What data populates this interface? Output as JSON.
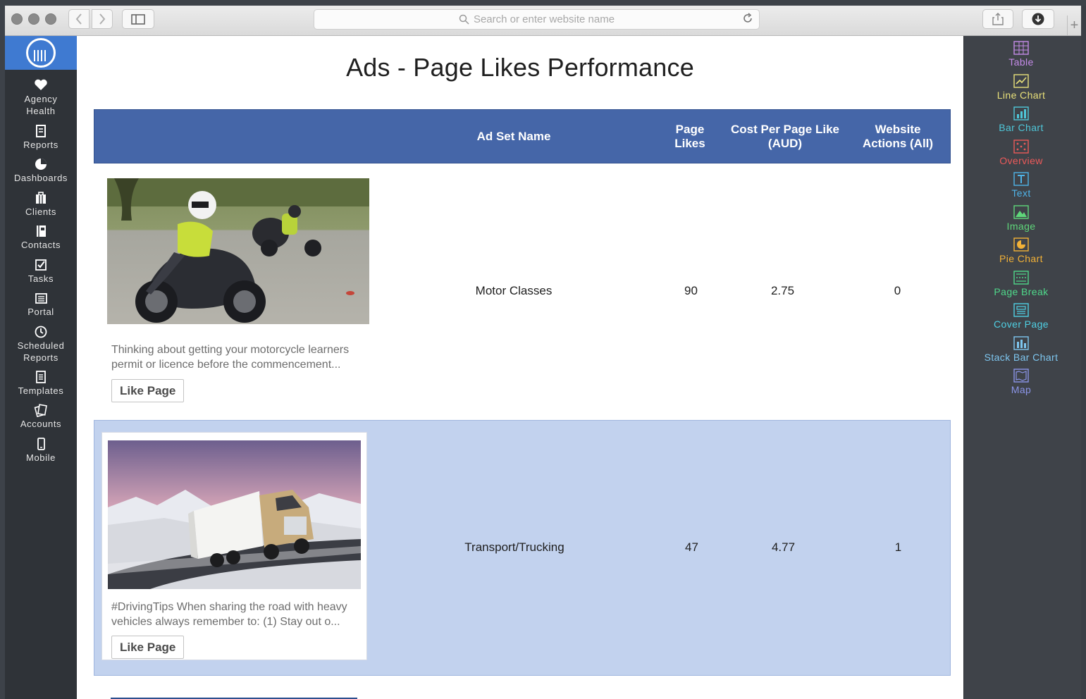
{
  "browser": {
    "address_placeholder": "Search or enter website name"
  },
  "sidebar": {
    "items": [
      {
        "line1": "Agency",
        "line2": "Health",
        "icon": "heart-icon"
      },
      {
        "line1": "Reports",
        "line2": "",
        "icon": "report-icon"
      },
      {
        "line1": "Dashboards",
        "line2": "",
        "icon": "pie-icon"
      },
      {
        "line1": "Clients",
        "line2": "",
        "icon": "briefcase-icon"
      },
      {
        "line1": "Contacts",
        "line2": "",
        "icon": "contacts-book-icon"
      },
      {
        "line1": "Tasks",
        "line2": "",
        "icon": "checkbox-icon"
      },
      {
        "line1": "Portal",
        "line2": "",
        "icon": "portal-icon"
      },
      {
        "line1": "Scheduled",
        "line2": "Reports",
        "icon": "clock-icon"
      },
      {
        "line1": "Templates",
        "line2": "",
        "icon": "template-icon"
      },
      {
        "line1": "Accounts",
        "line2": "",
        "icon": "cards-icon"
      },
      {
        "line1": "Mobile",
        "line2": "",
        "icon": "mobile-icon"
      }
    ]
  },
  "main": {
    "title": "Ads - Page Likes Performance",
    "columns": [
      {
        "line1": "Ad Set Name",
        "line2": ""
      },
      {
        "line1": "Page",
        "line2": "Likes"
      },
      {
        "line1": "Cost Per Page Like",
        "line2": "(AUD)"
      },
      {
        "line1": "Website",
        "line2": "Actions (All)"
      }
    ],
    "rows": [
      {
        "ad_text_1": "Thinking about getting your motorcycle learners",
        "ad_text_2": "permit or licence before the commencement...",
        "button": "Like Page",
        "ad_set_name": "Motor Classes",
        "page_likes": "90",
        "cost_per_like": "2.75",
        "website_actions": "0"
      },
      {
        "ad_text_1": "#DrivingTips When sharing the road with heavy",
        "ad_text_2": "vehicles always remember to: (1) Stay out o...",
        "button": "Like Page",
        "ad_set_name": "Transport/Trucking",
        "page_likes": "47",
        "cost_per_like": "4.77",
        "website_actions": "1"
      }
    ]
  },
  "widgets": [
    {
      "label": "Table",
      "color": "#c48be8",
      "icon": "table-icon"
    },
    {
      "label": "Line Chart",
      "color": "#e8e07a",
      "icon": "line-chart-icon"
    },
    {
      "label": "Bar Chart",
      "color": "#4fc7d9",
      "icon": "bar-chart-icon"
    },
    {
      "label": "Overview",
      "color": "#ec5a5a",
      "icon": "overview-icon"
    },
    {
      "label": "Text",
      "color": "#4fb3e8",
      "icon": "text-icon"
    },
    {
      "label": "Image",
      "color": "#5fd67a",
      "icon": "image-icon"
    },
    {
      "label": "Pie Chart",
      "color": "#f2b137",
      "icon": "pie-chart-icon"
    },
    {
      "label": "Page Break",
      "color": "#4fd88a",
      "icon": "page-break-icon"
    },
    {
      "label": "Cover Page",
      "color": "#4fd0e4",
      "icon": "cover-page-icon"
    },
    {
      "label": "Stack Bar Chart",
      "color": "#7ec6ef",
      "icon": "stack-bar-chart-icon"
    },
    {
      "label": "Map",
      "color": "#8b95e8",
      "icon": "map-icon"
    }
  ]
}
